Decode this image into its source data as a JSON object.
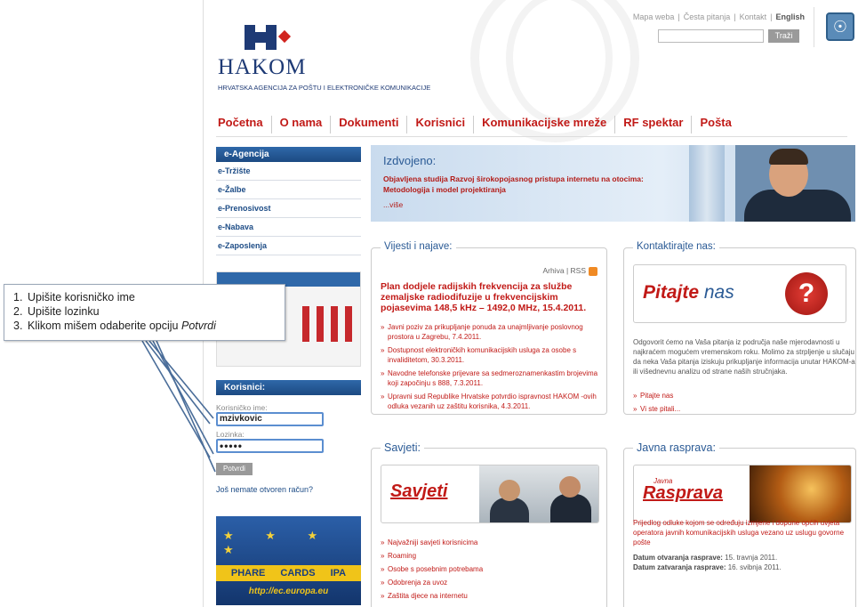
{
  "top_links": {
    "mapa": "Mapa weba",
    "pitanja": "Česta pitanja",
    "kontakt": "Kontakt",
    "english": "English",
    "sep": "|"
  },
  "search": {
    "button": "Traži",
    "placeholder": ""
  },
  "logo": {
    "word": "HAKOM",
    "subtitle": "HRVATSKA AGENCIJA ZA POŠTU I ELEKTRONIČKE KOMUNIKACIJE"
  },
  "nav": [
    "Početna",
    "O nama",
    "Dokumenti",
    "Korisnici",
    "Komunikacijske mreže",
    "RF spektar",
    "Pošta"
  ],
  "sidebar": {
    "title": "e-Agencija",
    "items": [
      "e-Tržište",
      "e-Žalbe",
      "e-Prenosivost",
      "e-Nabava",
      "e-Zaposlenja"
    ]
  },
  "login": {
    "title": "Korisnici:",
    "username_label": "Korisničko ime:",
    "username_value": "mzivkovic",
    "password_label": "Lozinka:",
    "password_value": "•••••",
    "submit": "Potvrdi",
    "no_account": "Još nemate otvoren račun?"
  },
  "eu_banner": {
    "stars": "★ ★ ★ ★",
    "programs": "PHARE CARDS IPA",
    "url": "http://ec.europa.eu"
  },
  "featured": {
    "title": "Izdvojeno:",
    "text": "Objavljena studija Razvoj širokopojasnog pristupa internetu na otocima: Metodologija i model projektiranja",
    "more": "...više"
  },
  "news": {
    "title": "Vijesti i najave:",
    "archive": "Arhiva | RSS",
    "headline": "Plan dodjele radijskih frekvencija za službe zemaljske radiodifuzije u frekvencijskim pojasevima 148,5 kHz – 1492,0 MHz, 15.4.2011.",
    "items": [
      "Javni poziv za prikupljanje ponuda za unajmljivanje poslovnog prostora u Zagrebu, 7.4.2011.",
      "Dostupnost elektroničkih komunikacijskih usluga za osobe s invaliditetom, 30.3.2011.",
      "Navodne telefonske prijevare sa sedmeroznamenkastim brojevima koji započinju s 888, 7.3.2011.",
      "Upravni sud Republike Hrvatske potvrdio ispravnost HAKOM -ovih odluka vezanih uz zaštitu korisnika, 4.3.2011."
    ]
  },
  "contact": {
    "title": "Kontaktirajte nas:",
    "banner_red": "Pitajte",
    "banner_blue": "nas",
    "qmark": "?",
    "text": "Odgovorit ćemo na Vaša pitanja iz područja naše mjerodavnosti u najkraćem mogućem vremenskom roku. Molimo za strpljenje u slučaju da neka Vaša pitanja iziskuju prikupljanje informacija unutar HAKOM-a ili višednevnu analizu od strane naših stručnjaka.",
    "links": [
      "Pitajte nas",
      "Vi ste pitali..."
    ]
  },
  "tips": {
    "title": "Savjeti:",
    "banner": "Savjeti",
    "items": [
      "Najvažniji savjeti korisnicima",
      "Roaming",
      "Osobe s posebnim potrebama",
      "Odobrenja za uvoz",
      "Zaštita djece na internetu"
    ]
  },
  "debate": {
    "title": "Javna rasprava:",
    "banner_small": "Javna",
    "banner": "Rasprava",
    "text": "Prijedlog odluke kojom se određuju izmjene i dopune općih uvjeta operatora javnih komunikacijskih usluga vezano uz uslugu govorne pošte",
    "open_label": "Datum otvaranja rasprave:",
    "open_date": "15. travnja 2011.",
    "close_label": "Datum zatvaranja rasprave:",
    "close_date": "16. svibnja 2011."
  },
  "callout": {
    "steps": [
      {
        "n": "1.",
        "text": "Upišite korisničko ime",
        "em": ""
      },
      {
        "n": "2.",
        "text": "Upišite lozinku",
        "em": ""
      },
      {
        "n": "3.",
        "text": "Klikom mišem odaberite opciju ",
        "em": "Potvrdi"
      }
    ]
  },
  "colors": {
    "brand_red": "#c11a17",
    "brand_blue": "#1e3a75",
    "sidebar_blue": "#2f68a9"
  }
}
